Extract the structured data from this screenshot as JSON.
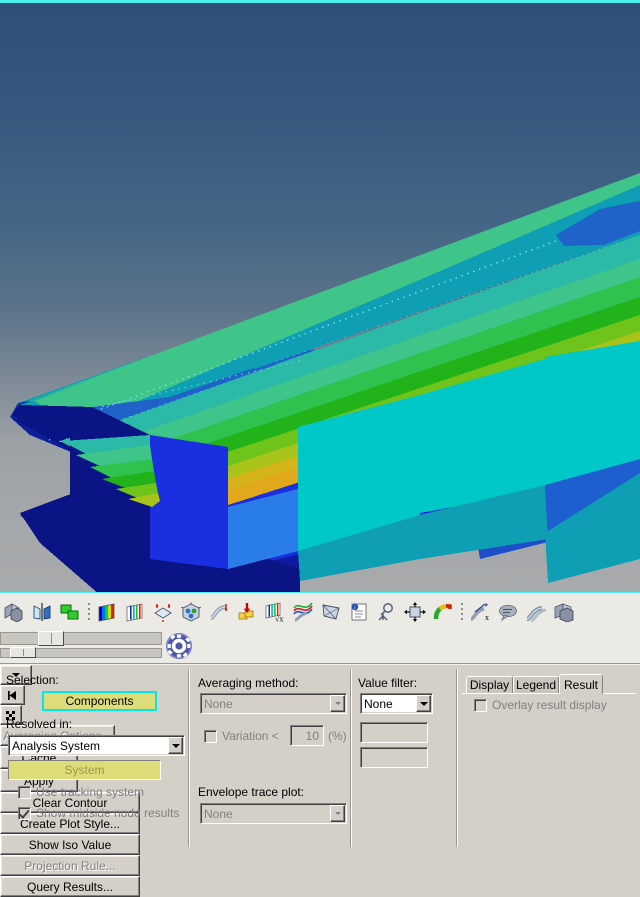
{
  "viewport": {
    "name": "fea-result-contour-viewport",
    "background_top": "#2e5077",
    "background_bottom": "#a8aaac",
    "border_color": "#4ff0f0",
    "model_description": "I-beam stress contour plot",
    "contour_colors": [
      "#00008f",
      "#0000d8",
      "#1a4fe8",
      "#2288e0",
      "#1f7fc4",
      "#0f9fb4",
      "#00bcd0",
      "#00c8c8",
      "#20bfae",
      "#3fc48a",
      "#3cc247",
      "#22b21a",
      "#6ec41a",
      "#a8c41a",
      "#d4b41a",
      "#e8a01a"
    ]
  },
  "toolbar": {
    "name": "graphics-toolbar",
    "icons": [
      "display-geometry-icon",
      "mirror-symmetry-icon",
      "multi-plot-icon",
      "toolbar-gripper-icon",
      "contour-plot-icon",
      "banded-contour-icon",
      "deformed-shape-icon",
      "iso-surface-icon",
      "vector-plot-icon",
      "load-arrow-icon",
      "contour-sqrt-icon",
      "trace-plot-icon",
      "wireframe-icon",
      "report-icon",
      "probe-query-icon",
      "move-scale-icon",
      "path-contour-icon",
      "toolbar-gripper-icon-2",
      "deform-scale-x-icon",
      "annotation-icon",
      "curve-plot-icon",
      "stack-plot-icon"
    ],
    "sliders": [
      {
        "name": "animation-slider",
        "value_pct": 34
      },
      {
        "name": "frame-slider",
        "value_pct": 10
      }
    ],
    "gear_icon": "settings-gear-icon"
  },
  "selection": {
    "label": "Selection:",
    "mode_dropdown_caret": "▼",
    "entity_value": "Components",
    "reset_button_glyph": "◄|"
  },
  "resolved_in": {
    "label": "Resolved in:",
    "value": "Analysis System",
    "system_value": "System",
    "system_button_glyph": "⁂",
    "use_tracking_system": {
      "label": "Use tracking system",
      "checked": false,
      "enabled": false
    },
    "show_midside_node_results": {
      "label": "Show midside node results",
      "checked": true,
      "enabled": false
    }
  },
  "averaging": {
    "label": "Averaging method:",
    "value": "None",
    "variation": {
      "label": "Variation <",
      "checked": false,
      "value": "10",
      "unit": "(%)"
    },
    "options_button": "Averaging Options..."
  },
  "envelope": {
    "label": "Envelope trace plot:",
    "value": "None"
  },
  "value_filter": {
    "label": "Value filter:",
    "value": "None",
    "min_value": "",
    "max_value": ""
  },
  "actions": {
    "cache": "Cache",
    "apply": "Apply"
  },
  "right_panel": {
    "tabs": [
      {
        "label": "Display",
        "active": false
      },
      {
        "label": "Legend",
        "active": false
      },
      {
        "label": "Result",
        "active": true
      }
    ],
    "overlay_checkbox": {
      "label": "Overlay result display",
      "checked": false,
      "enabled": false
    },
    "buttons": [
      {
        "label": "Clear Contour",
        "enabled": true
      },
      {
        "label": "Create Plot Style...",
        "enabled": true
      },
      {
        "label": "Show Iso Value",
        "enabled": true
      },
      {
        "label": "Projection Rule...",
        "enabled": false
      },
      {
        "label": "Query Results...",
        "enabled": true
      }
    ]
  }
}
